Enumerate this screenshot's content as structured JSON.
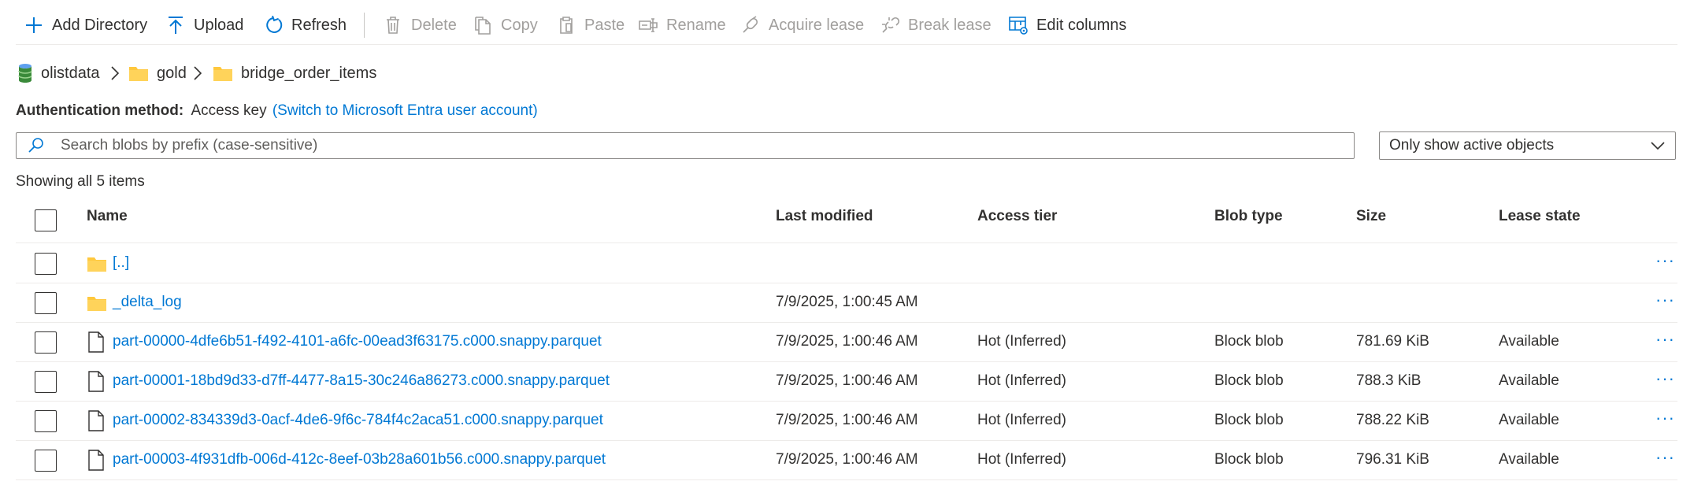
{
  "toolbar": {
    "add_directory": "Add Directory",
    "upload": "Upload",
    "refresh": "Refresh",
    "delete": "Delete",
    "copy": "Copy",
    "paste": "Paste",
    "rename": "Rename",
    "acquire_lease": "Acquire lease",
    "break_lease": "Break lease",
    "edit_columns": "Edit columns"
  },
  "breadcrumb": {
    "account": "olistdata",
    "folder1": "gold",
    "folder2": "bridge_order_items"
  },
  "auth": {
    "label": "Authentication method:",
    "value": "Access key",
    "link": "(Switch to Microsoft Entra user account)"
  },
  "search": {
    "placeholder": "Search blobs by prefix (case-sensitive)"
  },
  "filter": {
    "selected": "Only show active objects"
  },
  "showing": "Showing all 5 items",
  "columns": {
    "name": "Name",
    "last_modified": "Last modified",
    "access_tier": "Access tier",
    "blob_type": "Blob type",
    "size": "Size",
    "lease_state": "Lease state"
  },
  "rows": [
    {
      "name": "[..]",
      "modified": "",
      "tier": "",
      "type": "",
      "size": "",
      "lease": "",
      "more": "···"
    },
    {
      "name": "_delta_log",
      "modified": "7/9/2025, 1:00:45 AM",
      "tier": "",
      "type": "",
      "size": "",
      "lease": "",
      "more": "···"
    },
    {
      "name": "part-00000-4dfe6b51-f492-4101-a6fc-00ead3f63175.c000.snappy.parquet",
      "modified": "7/9/2025, 1:00:46 AM",
      "tier": "Hot (Inferred)",
      "type": "Block blob",
      "size": "781.69 KiB",
      "lease": "Available",
      "more": "···"
    },
    {
      "name": "part-00001-18bd9d33-d7ff-4477-8a15-30c246a86273.c000.snappy.parquet",
      "modified": "7/9/2025, 1:00:46 AM",
      "tier": "Hot (Inferred)",
      "type": "Block blob",
      "size": "788.3 KiB",
      "lease": "Available",
      "more": "···"
    },
    {
      "name": "part-00002-834339d3-0acf-4de6-9f6c-784f4c2aca51.c000.snappy.parquet",
      "modified": "7/9/2025, 1:00:46 AM",
      "tier": "Hot (Inferred)",
      "type": "Block blob",
      "size": "788.22 KiB",
      "lease": "Available",
      "more": "···"
    },
    {
      "name": "part-00003-4f931dfb-006d-412c-8eef-03b28a601b56.c000.snappy.parquet",
      "modified": "7/9/2025, 1:00:46 AM",
      "tier": "Hot (Inferred)",
      "type": "Block blob",
      "size": "796.31 KiB",
      "lease": "Available",
      "more": "···"
    }
  ],
  "colors": {
    "accent": "#0078d4",
    "folder": "#ffc83d",
    "disabled": "#a19f9d"
  }
}
